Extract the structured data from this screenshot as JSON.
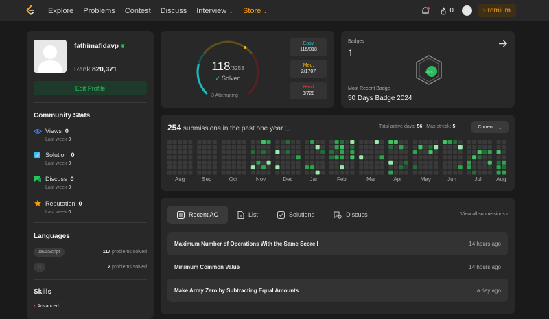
{
  "nav": {
    "links": [
      "Explore",
      "Problems",
      "Contest",
      "Discuss",
      "Interview",
      "Store"
    ],
    "streak": "0",
    "premium": "Premium"
  },
  "profile": {
    "username": "fathimafidavp",
    "rank_label": "Rank",
    "rank_value": "820,371",
    "edit_label": "Edit Profile"
  },
  "community": {
    "title": "Community Stats",
    "items": [
      {
        "label": "Views",
        "value": "0",
        "sub_label": "Last week",
        "sub_value": "0",
        "color": "#3b82f6"
      },
      {
        "label": "Solution",
        "value": "0",
        "sub_label": "Last week",
        "sub_value": "0",
        "color": "#38bdf8"
      },
      {
        "label": "Discuss",
        "value": "0",
        "sub_label": "Last week",
        "sub_value": "0",
        "color": "#22c55e"
      },
      {
        "label": "Reputation",
        "value": "0",
        "sub_label": "Last week",
        "sub_value": "0",
        "color": "#f59e0b"
      }
    ]
  },
  "languages": {
    "title": "Languages",
    "items": [
      {
        "name": "JavaScript",
        "count": "117",
        "unit": "problems solved"
      },
      {
        "name": "C",
        "count": "2",
        "unit": "problems solved"
      }
    ]
  },
  "skills": {
    "title": "Skills",
    "first": "Advanced"
  },
  "solved": {
    "count": "118",
    "total": "/3253",
    "label": "Solved",
    "attempting": "3 Attempting",
    "easy_label": "Easy",
    "easy_value": "116/818",
    "med_label": "Med.",
    "med_value": "2/1707",
    "hard_label": "Hard",
    "hard_value": "0/728",
    "solved_fraction": 0.036,
    "colors": {
      "easy": "#1cbaba",
      "medium": "#ffb700",
      "hard": "#f63737"
    }
  },
  "badges": {
    "title": "Badges",
    "count": "1",
    "recent_label": "Most Recent Badge",
    "recent_value": "50 Days Badge 2024",
    "badge_text": "DAYS"
  },
  "submissions": {
    "count": "254",
    "text": "submissions in the past one year",
    "active_label": "Total active days:",
    "active_value": "56",
    "streak_label": "Max streak:",
    "streak_value": "5",
    "period": "Current",
    "months": [
      "Aug",
      "Sep",
      "Oct",
      "Nov",
      "Dec",
      "Jan",
      "Feb",
      "Mar",
      "Apr",
      "May",
      "Jun",
      "Jul",
      "Aug"
    ]
  },
  "recent": {
    "tabs": [
      "Recent AC",
      "List",
      "Solutions",
      "Discuss"
    ],
    "view_all": "View all submissions",
    "rows": [
      {
        "title": "Maximum Number of Operations With the Same Score I",
        "time": "14 hours ago"
      },
      {
        "title": "Minimum Common Value",
        "time": "14 hours ago"
      },
      {
        "title": "Make Array Zero by Subtracting Equal Amounts",
        "time": "a day ago"
      }
    ]
  }
}
